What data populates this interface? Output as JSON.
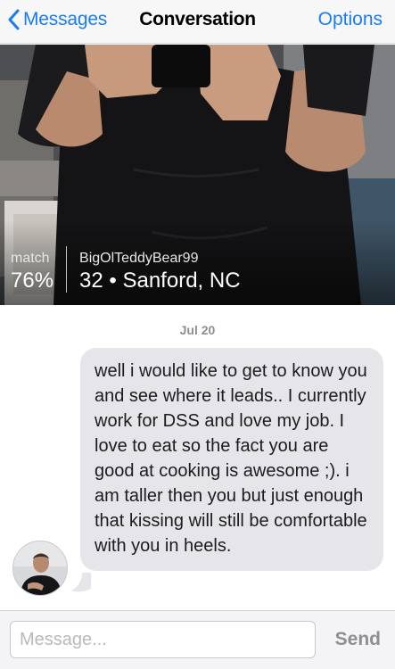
{
  "nav": {
    "back_label": "Messages",
    "title": "Conversation",
    "options_label": "Options"
  },
  "profile": {
    "match_label": "match",
    "match_value": "76%",
    "username": "BigOlTeddyBear99",
    "details": "32 • Sanford, NC"
  },
  "thread": {
    "date": "Jul 20",
    "messages": [
      {
        "from": "BigOlTeddyBear99",
        "text": "well i would like to get to know you and see where it leads.. I currently work for DSS and love my job. I love to eat so the fact you are good at cooking is awesome ;). i am taller then you but just enough that kissing will still be comfortable with you in heels."
      }
    ]
  },
  "compose": {
    "placeholder": "Message...",
    "send_label": "Send"
  },
  "colors": {
    "accent": "#1a7cf5",
    "bubble": "#e5e5ea",
    "date_text": "#8e8e93"
  }
}
